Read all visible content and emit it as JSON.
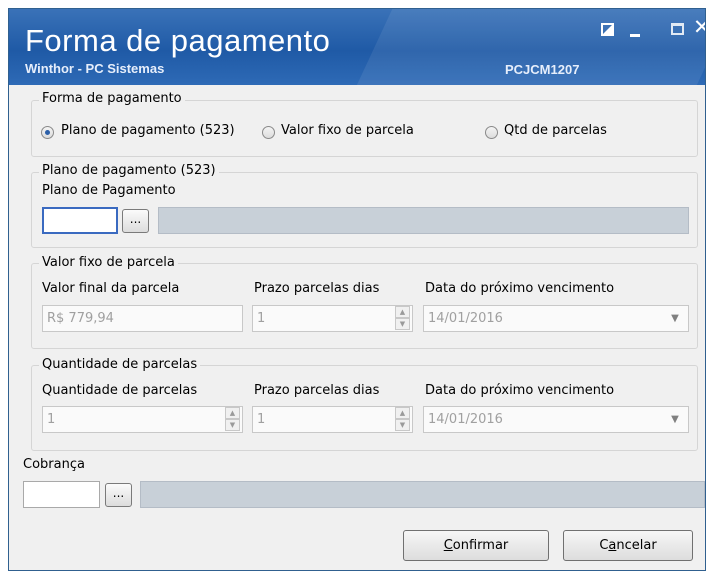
{
  "window": {
    "title": "Forma de pagamento",
    "subtitle": "Winthor - PC Sistemas",
    "code": "PCJCM1207"
  },
  "forma_pagamento": {
    "legend": "Forma de pagamento",
    "options": [
      {
        "label": "Plano de pagamento (523)",
        "selected": true
      },
      {
        "label": "Valor fixo de parcela",
        "selected": false
      },
      {
        "label": "Qtd de parcelas",
        "selected": false
      }
    ]
  },
  "plano": {
    "legend": "Plano de pagamento (523)",
    "field_label": "Plano de Pagamento",
    "value": "",
    "lookup_label": "..."
  },
  "valor_fixo": {
    "legend": "Valor fixo de parcela",
    "valor_label": "Valor final da parcela",
    "valor_value": "R$ 779,94",
    "prazo_label": "Prazo parcelas dias",
    "prazo_value": "1",
    "data_label": "Data do próximo vencimento",
    "data_value": "14/01/2016"
  },
  "quantidade": {
    "legend": "Quantidade de parcelas",
    "qtd_label": "Quantidade de parcelas",
    "qtd_value": "1",
    "prazo_label": "Prazo parcelas dias",
    "prazo_value": "1",
    "data_label": "Data do próximo vencimento",
    "data_value": "14/01/2016"
  },
  "cobranca": {
    "label": "Cobrança",
    "value": "",
    "lookup_label": "..."
  },
  "buttons": {
    "confirmar_first": "C",
    "confirmar_rest": "onfirmar",
    "cancelar_first": "C",
    "cancelar_underline": "a",
    "cancelar_rest": "ncelar"
  },
  "colors": {
    "titlebar": "#1f5aa6",
    "window_bg": "#f0f0f0",
    "focus_border": "#3a6ac0",
    "desc_box": "#c8d0d8"
  },
  "icons": {
    "restore": "restore-icon",
    "minimize": "minimize-icon",
    "maximize": "maximize-icon",
    "close": "close-icon"
  }
}
